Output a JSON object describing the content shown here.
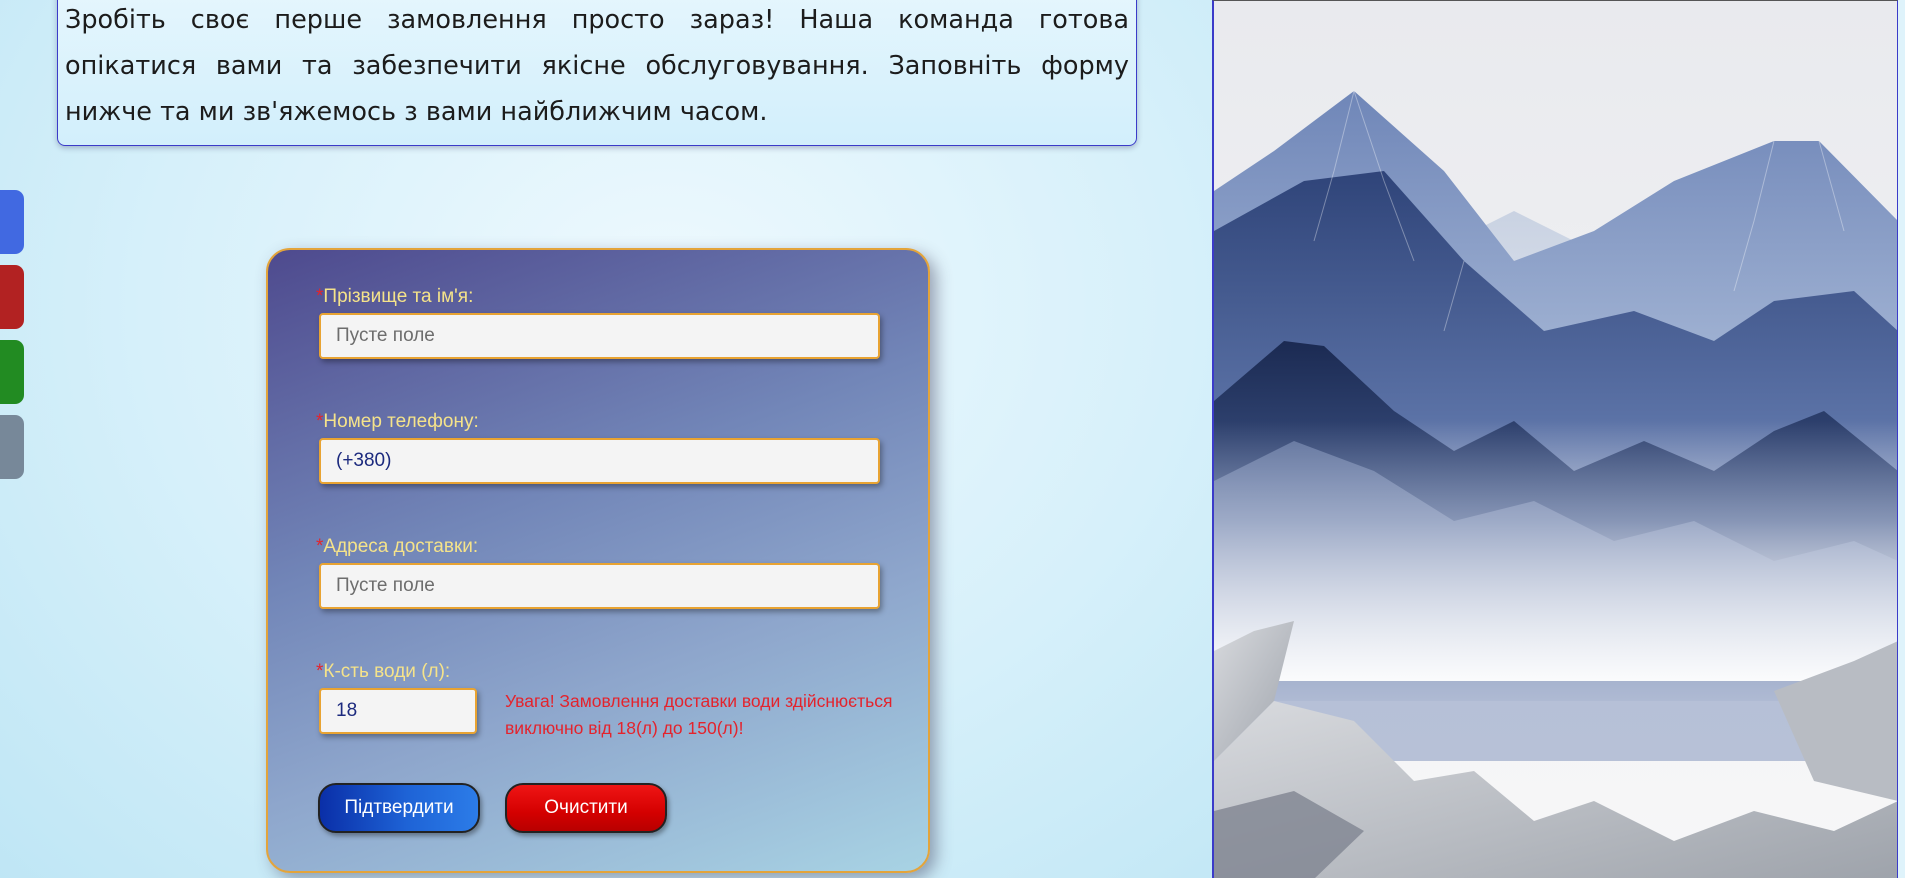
{
  "intro": {
    "text": "Зробіть своє перше замовлення просто зараз! Наша команда готова опікатися вами та забезпечити якісне обслуговування. Заповніть форму нижче та ми зв'яжемось з вами найближчим часом."
  },
  "side_tabs": [
    {
      "color": "#4169e1"
    },
    {
      "color": "#b22222"
    },
    {
      "color": "#228b22"
    },
    {
      "color": "#778899"
    }
  ],
  "form": {
    "required_mark": "*",
    "fields": [
      {
        "label": "Прізвище та ім'я:",
        "placeholder": "Пусте поле",
        "value": ""
      },
      {
        "label": "Номер телефону:",
        "placeholder": "",
        "value": "(+380)"
      },
      {
        "label": "Адреса доставки:",
        "placeholder": "Пусте поле",
        "value": ""
      },
      {
        "label": "К-сть води (л):",
        "placeholder": "",
        "value": "18"
      }
    ],
    "warning": "Увага! Замовлення доставки води здійснюється виключно від 18(л) до 150(л)!",
    "submit_label": "Підтвердити",
    "clear_label": "Очистити"
  },
  "colors": {
    "label": "#f5e38a",
    "required": "#e4232c",
    "input_border": "#e8a332",
    "submit": "#1e4fc8",
    "clear": "#d40000"
  }
}
